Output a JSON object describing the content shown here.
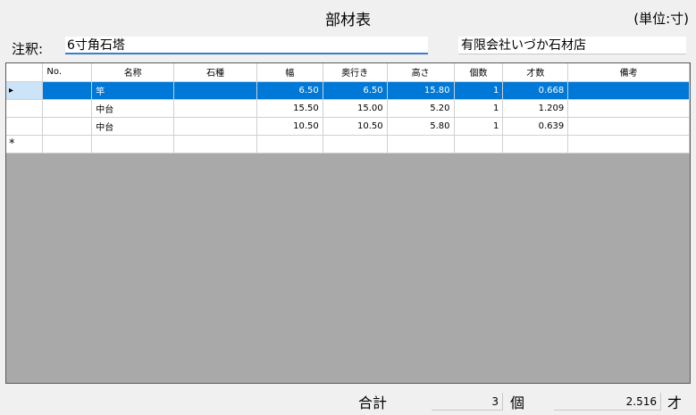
{
  "title": "部材表",
  "unit_label": "(単位:寸)",
  "note": {
    "label": "注釈:",
    "value": "6寸角石塔"
  },
  "company": {
    "value": "有限会社いづか石材店"
  },
  "grid": {
    "columns": [
      "No.",
      "名称",
      "石種",
      "幅",
      "奥行き",
      "高さ",
      "個数",
      "才数",
      "備考"
    ],
    "rows": [
      {
        "indicator": "▸",
        "no": "",
        "name": "竿",
        "stone": "",
        "width": "6.50",
        "depth": "6.50",
        "height": "15.80",
        "count": "1",
        "sai": "0.668",
        "remarks": ""
      },
      {
        "indicator": "",
        "no": "",
        "name": "中台",
        "stone": "",
        "width": "15.50",
        "depth": "15.00",
        "height": "5.20",
        "count": "1",
        "sai": "1.209",
        "remarks": ""
      },
      {
        "indicator": "",
        "no": "",
        "name": "中台",
        "stone": "",
        "width": "10.50",
        "depth": "10.50",
        "height": "5.80",
        "count": "1",
        "sai": "0.639",
        "remarks": ""
      }
    ],
    "new_row_marker": "*"
  },
  "footer": {
    "total_label": "合計",
    "count_value": "3",
    "count_unit": "個",
    "total_value": "2.516",
    "total_unit": "才"
  }
}
